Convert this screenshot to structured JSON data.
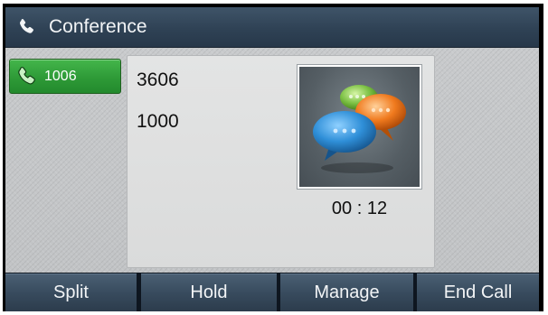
{
  "header": {
    "title": "Conference",
    "icon": "phone-icon"
  },
  "line_key": {
    "label": "1006",
    "icon": "phone-icon",
    "color": "#2e9a37"
  },
  "call": {
    "parties": [
      "3606",
      "1000"
    ],
    "avatar_icon": "chat-bubbles-icon",
    "duration": "00 : 12"
  },
  "softkeys": [
    "Split",
    "Hold",
    "Manage",
    "End Call"
  ],
  "colors": {
    "titlebar": "#2f4255",
    "softkey": "#384b5e",
    "bubble_blue": "#2f8fd8",
    "bubble_orange": "#f07a1e",
    "bubble_green": "#7bc043"
  }
}
